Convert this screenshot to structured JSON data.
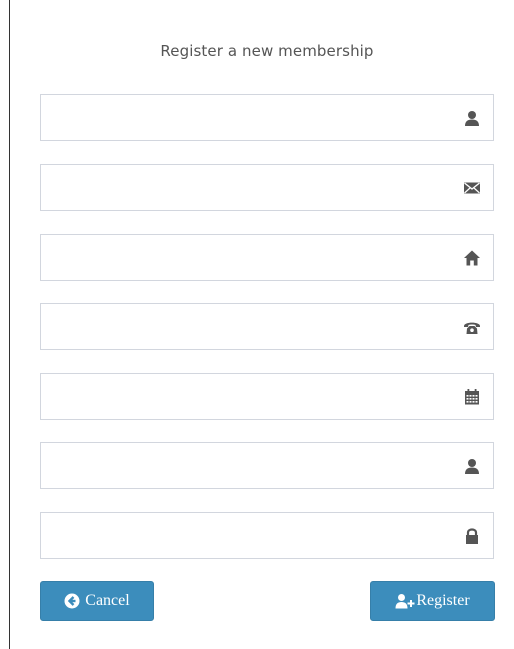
{
  "form": {
    "title": "Register a new membership",
    "fields": [
      {
        "name": "full-name",
        "value": "",
        "placeholder": "",
        "icon": "user-icon"
      },
      {
        "name": "email",
        "value": "",
        "placeholder": "",
        "icon": "envelope-icon"
      },
      {
        "name": "address",
        "value": "",
        "placeholder": "",
        "icon": "home-icon"
      },
      {
        "name": "phone",
        "value": "",
        "placeholder": "",
        "icon": "phone-icon"
      },
      {
        "name": "date",
        "value": "",
        "placeholder": "",
        "icon": "calendar-icon"
      },
      {
        "name": "username",
        "value": "",
        "placeholder": "",
        "icon": "user-icon"
      },
      {
        "name": "password",
        "value": "",
        "placeholder": "",
        "icon": "lock-icon"
      }
    ]
  },
  "buttons": {
    "cancel_label": "Cancel",
    "cancel_icon": "arrow-circle-left-icon",
    "register_label": "Register",
    "register_icon": "user-plus-icon"
  },
  "colors": {
    "primary": "#3c8dbc",
    "primary_border": "#367fa9",
    "input_border": "#d2d6de",
    "icon": "#555555",
    "title_text": "#555555"
  }
}
